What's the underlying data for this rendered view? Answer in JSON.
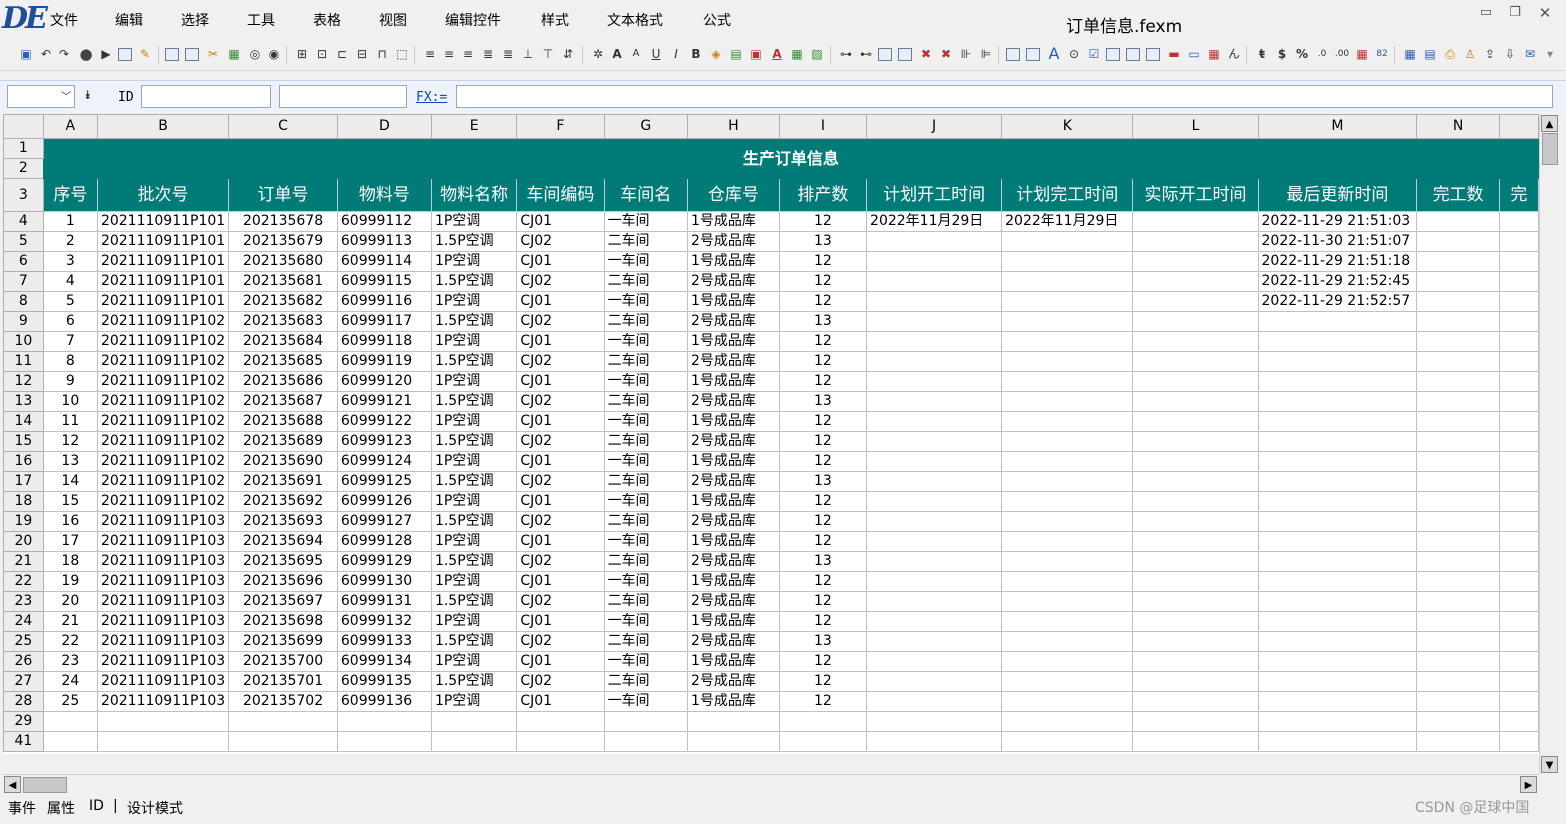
{
  "app": {
    "title": "订单信息.fexm",
    "menu": [
      "文件",
      "编辑",
      "选择",
      "工具",
      "表格",
      "视图",
      "编辑控件",
      "样式",
      "文本格式",
      "公式"
    ]
  },
  "formula_bar": {
    "cell_ref": "",
    "id_label": "ID",
    "id_value": "",
    "name_value": "",
    "fx_label": "FX:=",
    "formula": ""
  },
  "sheet": {
    "columns": [
      "A",
      "B",
      "C",
      "D",
      "E",
      "F",
      "G",
      "H",
      "I",
      "J",
      "K",
      "L",
      "M",
      "N",
      ""
    ],
    "banner": "生产订单信息",
    "headers": [
      "序号",
      "批次号",
      "订单号",
      "物料号",
      "物料名称",
      "车间编码",
      "车间名",
      "仓库号",
      "排产数",
      "计划开工时间",
      "计划完工时间",
      "实际开工时间",
      "最后更新时间",
      "完工数",
      "完"
    ],
    "rows": [
      {
        "n": "4",
        "seq": "1",
        "batch": "2021110911P101",
        "order": "202135678",
        "mat": "60999112",
        "name": "1P空调",
        "ws": "CJ01",
        "wsn": "一车间",
        "wh": "1号成品库",
        "qty": "12",
        "ps": "2022年11月29日",
        "pe": "2022年11月29日",
        "as": "",
        "upd": "2022-11-29 21:51:03"
      },
      {
        "n": "5",
        "seq": "2",
        "batch": "2021110911P101",
        "order": "202135679",
        "mat": "60999113",
        "name": "1.5P空调",
        "ws": "CJ02",
        "wsn": "二车间",
        "wh": "2号成品库",
        "qty": "13",
        "ps": "",
        "pe": "",
        "as": "",
        "upd": "2022-11-30 21:51:07"
      },
      {
        "n": "6",
        "seq": "3",
        "batch": "2021110911P101",
        "order": "202135680",
        "mat": "60999114",
        "name": "1P空调",
        "ws": "CJ01",
        "wsn": "一车间",
        "wh": "1号成品库",
        "qty": "12",
        "ps": "",
        "pe": "",
        "as": "",
        "upd": "2022-11-29 21:51:18"
      },
      {
        "n": "7",
        "seq": "4",
        "batch": "2021110911P101",
        "order": "202135681",
        "mat": "60999115",
        "name": "1.5P空调",
        "ws": "CJ02",
        "wsn": "二车间",
        "wh": "2号成品库",
        "qty": "12",
        "ps": "",
        "pe": "",
        "as": "",
        "upd": "2022-11-29 21:52:45"
      },
      {
        "n": "8",
        "seq": "5",
        "batch": "2021110911P101",
        "order": "202135682",
        "mat": "60999116",
        "name": "1P空调",
        "ws": "CJ01",
        "wsn": "一车间",
        "wh": "1号成品库",
        "qty": "12",
        "ps": "",
        "pe": "",
        "as": "",
        "upd": "2022-11-29 21:52:57"
      },
      {
        "n": "9",
        "seq": "6",
        "batch": "2021110911P102",
        "order": "202135683",
        "mat": "60999117",
        "name": "1.5P空调",
        "ws": "CJ02",
        "wsn": "二车间",
        "wh": "2号成品库",
        "qty": "13",
        "ps": "",
        "pe": "",
        "as": "",
        "upd": ""
      },
      {
        "n": "10",
        "seq": "7",
        "batch": "2021110911P102",
        "order": "202135684",
        "mat": "60999118",
        "name": "1P空调",
        "ws": "CJ01",
        "wsn": "一车间",
        "wh": "1号成品库",
        "qty": "12",
        "ps": "",
        "pe": "",
        "as": "",
        "upd": ""
      },
      {
        "n": "11",
        "seq": "8",
        "batch": "2021110911P102",
        "order": "202135685",
        "mat": "60999119",
        "name": "1.5P空调",
        "ws": "CJ02",
        "wsn": "二车间",
        "wh": "2号成品库",
        "qty": "12",
        "ps": "",
        "pe": "",
        "as": "",
        "upd": ""
      },
      {
        "n": "12",
        "seq": "9",
        "batch": "2021110911P102",
        "order": "202135686",
        "mat": "60999120",
        "name": "1P空调",
        "ws": "CJ01",
        "wsn": "一车间",
        "wh": "1号成品库",
        "qty": "12",
        "ps": "",
        "pe": "",
        "as": "",
        "upd": ""
      },
      {
        "n": "13",
        "seq": "10",
        "batch": "2021110911P102",
        "order": "202135687",
        "mat": "60999121",
        "name": "1.5P空调",
        "ws": "CJ02",
        "wsn": "二车间",
        "wh": "2号成品库",
        "qty": "13",
        "ps": "",
        "pe": "",
        "as": "",
        "upd": ""
      },
      {
        "n": "14",
        "seq": "11",
        "batch": "2021110911P102",
        "order": "202135688",
        "mat": "60999122",
        "name": "1P空调",
        "ws": "CJ01",
        "wsn": "一车间",
        "wh": "1号成品库",
        "qty": "12",
        "ps": "",
        "pe": "",
        "as": "",
        "upd": ""
      },
      {
        "n": "15",
        "seq": "12",
        "batch": "2021110911P102",
        "order": "202135689",
        "mat": "60999123",
        "name": "1.5P空调",
        "ws": "CJ02",
        "wsn": "二车间",
        "wh": "2号成品库",
        "qty": "12",
        "ps": "",
        "pe": "",
        "as": "",
        "upd": ""
      },
      {
        "n": "16",
        "seq": "13",
        "batch": "2021110911P102",
        "order": "202135690",
        "mat": "60999124",
        "name": "1P空调",
        "ws": "CJ01",
        "wsn": "一车间",
        "wh": "1号成品库",
        "qty": "12",
        "ps": "",
        "pe": "",
        "as": "",
        "upd": ""
      },
      {
        "n": "17",
        "seq": "14",
        "batch": "2021110911P102",
        "order": "202135691",
        "mat": "60999125",
        "name": "1.5P空调",
        "ws": "CJ02",
        "wsn": "二车间",
        "wh": "2号成品库",
        "qty": "13",
        "ps": "",
        "pe": "",
        "as": "",
        "upd": ""
      },
      {
        "n": "18",
        "seq": "15",
        "batch": "2021110911P102",
        "order": "202135692",
        "mat": "60999126",
        "name": "1P空调",
        "ws": "CJ01",
        "wsn": "一车间",
        "wh": "1号成品库",
        "qty": "12",
        "ps": "",
        "pe": "",
        "as": "",
        "upd": ""
      },
      {
        "n": "19",
        "seq": "16",
        "batch": "2021110911P103",
        "order": "202135693",
        "mat": "60999127",
        "name": "1.5P空调",
        "ws": "CJ02",
        "wsn": "二车间",
        "wh": "2号成品库",
        "qty": "12",
        "ps": "",
        "pe": "",
        "as": "",
        "upd": ""
      },
      {
        "n": "20",
        "seq": "17",
        "batch": "2021110911P103",
        "order": "202135694",
        "mat": "60999128",
        "name": "1P空调",
        "ws": "CJ01",
        "wsn": "一车间",
        "wh": "1号成品库",
        "qty": "12",
        "ps": "",
        "pe": "",
        "as": "",
        "upd": ""
      },
      {
        "n": "21",
        "seq": "18",
        "batch": "2021110911P103",
        "order": "202135695",
        "mat": "60999129",
        "name": "1.5P空调",
        "ws": "CJ02",
        "wsn": "二车间",
        "wh": "2号成品库",
        "qty": "13",
        "ps": "",
        "pe": "",
        "as": "",
        "upd": ""
      },
      {
        "n": "22",
        "seq": "19",
        "batch": "2021110911P103",
        "order": "202135696",
        "mat": "60999130",
        "name": "1P空调",
        "ws": "CJ01",
        "wsn": "一车间",
        "wh": "1号成品库",
        "qty": "12",
        "ps": "",
        "pe": "",
        "as": "",
        "upd": ""
      },
      {
        "n": "23",
        "seq": "20",
        "batch": "2021110911P103",
        "order": "202135697",
        "mat": "60999131",
        "name": "1.5P空调",
        "ws": "CJ02",
        "wsn": "二车间",
        "wh": "2号成品库",
        "qty": "12",
        "ps": "",
        "pe": "",
        "as": "",
        "upd": ""
      },
      {
        "n": "24",
        "seq": "21",
        "batch": "2021110911P103",
        "order": "202135698",
        "mat": "60999132",
        "name": "1P空调",
        "ws": "CJ01",
        "wsn": "一车间",
        "wh": "1号成品库",
        "qty": "12",
        "ps": "",
        "pe": "",
        "as": "",
        "upd": ""
      },
      {
        "n": "25",
        "seq": "22",
        "batch": "2021110911P103",
        "order": "202135699",
        "mat": "60999133",
        "name": "1.5P空调",
        "ws": "CJ02",
        "wsn": "二车间",
        "wh": "2号成品库",
        "qty": "13",
        "ps": "",
        "pe": "",
        "as": "",
        "upd": ""
      },
      {
        "n": "26",
        "seq": "23",
        "batch": "2021110911P103",
        "order": "202135700",
        "mat": "60999134",
        "name": "1P空调",
        "ws": "CJ01",
        "wsn": "一车间",
        "wh": "1号成品库",
        "qty": "12",
        "ps": "",
        "pe": "",
        "as": "",
        "upd": ""
      },
      {
        "n": "27",
        "seq": "24",
        "batch": "2021110911P103",
        "order": "202135701",
        "mat": "60999135",
        "name": "1.5P空调",
        "ws": "CJ02",
        "wsn": "二车间",
        "wh": "2号成品库",
        "qty": "12",
        "ps": "",
        "pe": "",
        "as": "",
        "upd": ""
      },
      {
        "n": "28",
        "seq": "25",
        "batch": "2021110911P103",
        "order": "202135702",
        "mat": "60999136",
        "name": "1P空调",
        "ws": "CJ01",
        "wsn": "一车间",
        "wh": "1号成品库",
        "qty": "12",
        "ps": "",
        "pe": "",
        "as": "",
        "upd": ""
      }
    ],
    "trailing_rows": [
      "29",
      "41"
    ]
  },
  "bottom_tabs": [
    "事件",
    "属性",
    "ID",
    "|",
    "设计模式"
  ],
  "watermark": "CSDN @足球中国",
  "colors": {
    "accent": "#007b78",
    "link": "#1f3fbf"
  }
}
